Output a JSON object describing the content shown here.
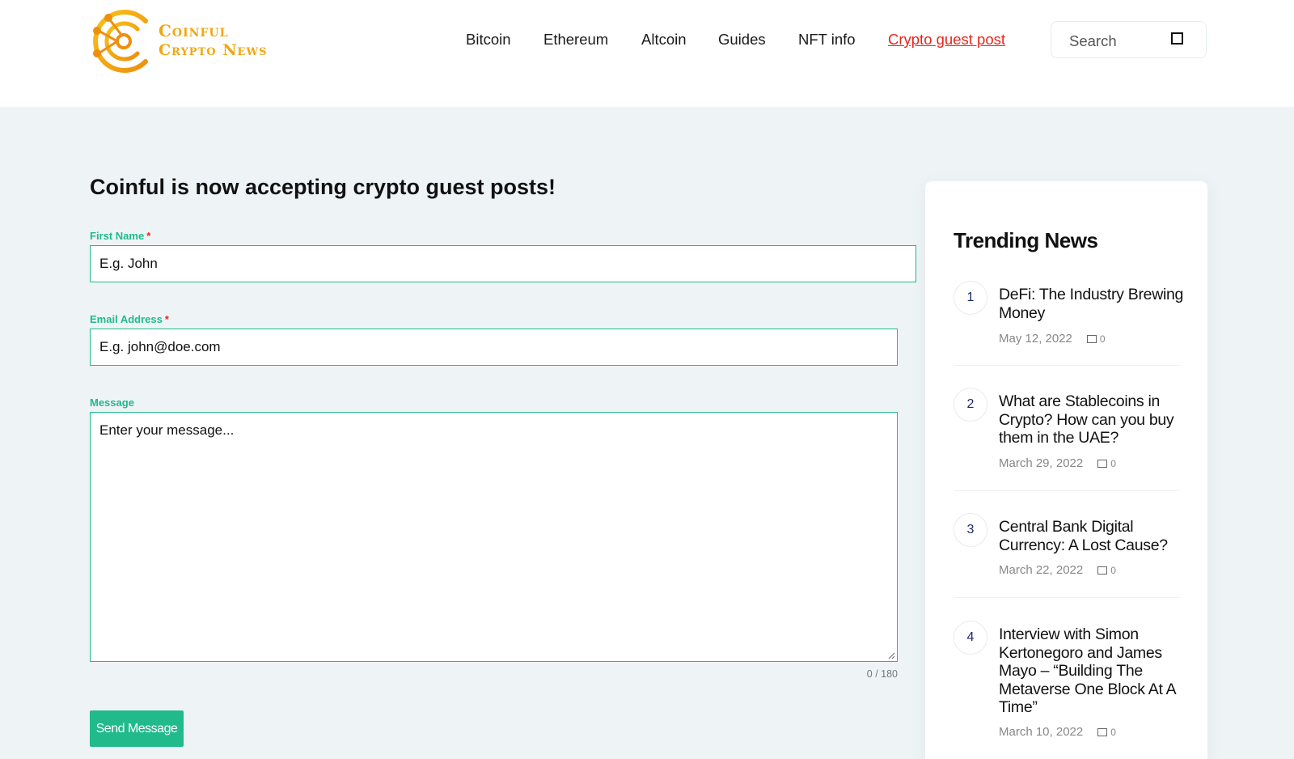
{
  "brand": {
    "line1": "Coinful",
    "line2": "Crypto News",
    "accent": "#f2a60f"
  },
  "nav": {
    "items": [
      {
        "label": "Bitcoin",
        "active": false
      },
      {
        "label": "Ethereum",
        "active": false
      },
      {
        "label": "Altcoin",
        "active": false
      },
      {
        "label": "Guides",
        "active": false
      },
      {
        "label": "NFT info",
        "active": false
      },
      {
        "label": "Crypto guest post",
        "active": true
      }
    ],
    "active_color": "#e8261c"
  },
  "search": {
    "placeholder": "Search",
    "icon": "search-icon"
  },
  "form": {
    "heading": "Coinful is now accepting crypto guest posts!",
    "first_name": {
      "label": "First Name",
      "required_mark": "*",
      "placeholder": "E.g. John"
    },
    "email": {
      "label": "Email Address",
      "required_mark": "*",
      "placeholder": "E.g. john@doe.com"
    },
    "message": {
      "label": "Message",
      "placeholder": "Enter your message...",
      "counter": "0 / 180"
    },
    "submit_label": "Send Message",
    "accent_color": "#21ba8a"
  },
  "sidebar": {
    "title": "Trending News",
    "items": [
      {
        "num": "1",
        "title": "DeFi: The Industry Brewing Money",
        "date": "May 12, 2022",
        "comments": "0"
      },
      {
        "num": "2",
        "title": "What are Stablecoins in Crypto? How can you buy them in the UAE?",
        "date": "March 29, 2022",
        "comments": "0"
      },
      {
        "num": "3",
        "title": "Central Bank Digital Currency: A Lost Cause?",
        "date": "March 22, 2022",
        "comments": "0"
      },
      {
        "num": "4",
        "title": "Interview with Simon Kertonegoro and James Mayo – “Building The Metaverse One Block At A Time”",
        "date": "March 10, 2022",
        "comments": "0"
      }
    ]
  }
}
